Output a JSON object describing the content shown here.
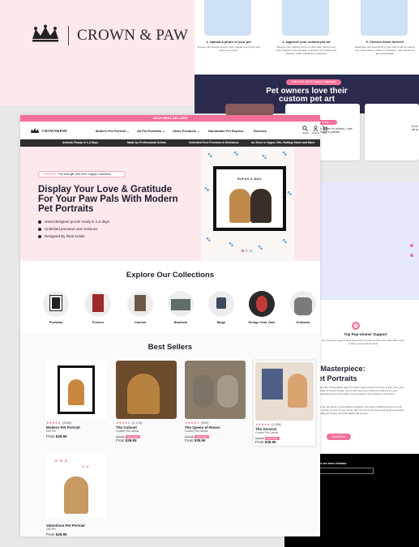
{
  "brand": {
    "name": "CROWN & PAW",
    "small_name": "CROWN&PAW"
  },
  "steps": [
    {
      "title": "1. Upload a photo of your pet",
      "desc": "Choose your favorite artwork style, upload a pet photo and place your order!"
    },
    {
      "title": "2. Approve your custom pet art",
      "desc": "Receive your artwork proof in 2 days after placing your order. Request any changes or approve the printing and shipping. 100% satisfaction guarantee!"
    },
    {
      "title": "3. Cherish these forever!",
      "desc": "Showcase your best friend in your wall or gift the perfect one. Remember to share on Instagram, and mention us @crownandpaw!"
    }
  ],
  "reviews": {
    "badge": "★★★★★ 100% Happy Customers",
    "title_line1": "Pet owners love their",
    "title_line2": "custom pet art",
    "quote1": "Loved how great it was before it's printed, I was in love with Chloe's portrait!",
    "quote2_partial": "Exce wit ar"
  },
  "support": {
    "title": "Top Pup-otomer Support",
    "desc": "Our customer support team work 24/7 to email us with a live chat. We're here to help, and we all the time!",
    "heading_line1": "t Photo to Masterpiece:",
    "heading_line2": "Custom Pet Portraits",
    "para1": "unique portrait pet products! Capture the unforgettable ngle from with unique pieces at Crown & Paw. Turn your ve in your heart and within your family. At Crown & Paw, ments with these our unique pet offering by your beloved ite into perfection: their celebrated bowl memorising moment always their presence and charm.",
    "para2": "Order a deep portrait for yours, we are pet artists, ic and skilled canvases. Our team of skilling these from rich whose talents, resulting in unique custom pet ture to your home. We put a lot of our times and dygined portraits from pictures, ensuring that are quality and joyful, and potentially hold all your.",
    "button": "Read More",
    "email_title": "your email for pup-dates on new release",
    "email_placeholder": "ter your email address here"
  },
  "topbar": "SHOP BEST SELLERS",
  "nav": {
    "items": [
      "Modern Pet Portrait",
      "All Pet Portraits",
      "Other Products",
      "Handmade Pet Replica",
      "Reviews"
    ],
    "icons": [
      "Search",
      "Account",
      "Cart"
    ]
  },
  "usps": [
    "Artwork Ready in 1-3 Days",
    "Made by Professional Artists",
    "Unlimited Free Previews & Revisions",
    "As Seen in Vogue, Elle, Rolling Stone and More"
  ],
  "hero": {
    "badge_stars": "★★★★★",
    "badge_text": "\"The best gift\" 500,000+ Happy Customers",
    "heading": "Display Your Love & Gratitude For Your Paw Pals With Modern Pet Portraits",
    "bullets": [
      "Hand-designed proofs ready in 1-2 days",
      "Unlimited previews and revisions",
      "Designed By Real Artists"
    ],
    "frame_caption": "RUFUS & MAX"
  },
  "collections": {
    "title": "Explore Our Collections",
    "items": [
      "Portraits",
      "Posters",
      "Canvas",
      "Blankets",
      "Mugs",
      "Design Your Own",
      "Knitwear"
    ]
  },
  "best_sellers": {
    "title": "Best Sellers",
    "products": [
      {
        "name": "Modern Pet Portrait",
        "sub": "One Pet",
        "stars": "★★★★★",
        "reviews": "(3082)",
        "from": "From",
        "price": "$39.95",
        "old_price": "",
        "badge": ""
      },
      {
        "name": "The Colonel",
        "sub": "Custom Pet Canvas",
        "stars": "★★★★★",
        "reviews": "(1,278)",
        "from": "From",
        "price": "$39.95",
        "old_price": "$79.95",
        "badge": "Save 50%"
      },
      {
        "name": "The Queen of Roses",
        "sub": "Custom Pet Canvas",
        "stars": "★★★★★",
        "reviews": "(980)",
        "from": "From",
        "price": "$39.95",
        "old_price": "$79.95",
        "badge": "Save 50%"
      },
      {
        "name": "The General",
        "sub": "Custom Pet Canvas",
        "stars": "★★★★★",
        "reviews": "(1,806)",
        "from": "From",
        "price": "$39.95",
        "old_price": "$79.95",
        "badge": "Save 50%"
      },
      {
        "name": "Valentines Pet Portrait",
        "sub": "One Pet",
        "stars": "",
        "reviews": "",
        "from": "From",
        "price": "$39.95",
        "old_price": "",
        "badge": ""
      }
    ]
  },
  "colors": {
    "accent": "#f37199",
    "navy": "#2a2b4d",
    "pink_bg": "#fde8ec",
    "dark": "#1c1c2e"
  }
}
